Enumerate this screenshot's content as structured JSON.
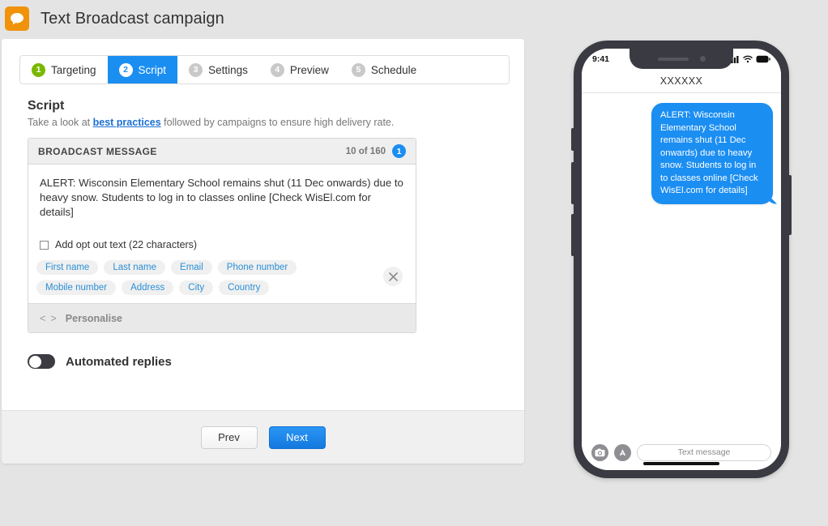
{
  "header": {
    "title": "Text Broadcast campaign",
    "app_icon": "speech-bubble-icon"
  },
  "steps": [
    {
      "num": "1",
      "label": "Targeting",
      "state": "done"
    },
    {
      "num": "2",
      "label": "Script",
      "state": "active"
    },
    {
      "num": "3",
      "label": "Settings",
      "state": "todo"
    },
    {
      "num": "4",
      "label": "Preview",
      "state": "todo"
    },
    {
      "num": "5",
      "label": "Schedule",
      "state": "todo"
    }
  ],
  "script": {
    "heading": "Script",
    "sub_prefix": "Take a look at ",
    "sub_link": "best practices",
    "sub_suffix": " followed by campaigns to ensure high delivery rate."
  },
  "composer": {
    "head_label": "BROADCAST MESSAGE",
    "char_count": "10 of 160",
    "segment_badge": "1",
    "message": "ALERT: Wisconsin Elementary School remains shut (11 Dec onwards) due to heavy snow. Students to log in to classes online [Check WisEl.com for details]",
    "optout_label": "Add opt out text (22 characters)",
    "close_icon": "close-icon",
    "chips": [
      "First name",
      "Last name",
      "Email",
      "Phone number",
      "Mobile number",
      "Address",
      "City",
      "Country"
    ],
    "footer_icon": "< >",
    "footer_label": "Personalise"
  },
  "automated": {
    "label": "Automated replies",
    "enabled": false
  },
  "footer": {
    "prev_label": "Prev",
    "next_label": "Next"
  },
  "phone": {
    "time": "9:41",
    "contact": "XXXXXX",
    "bubble_text": "ALERT: Wisconsin Elementary School remains shut (11 Dec onwards) due to heavy snow. Students to log in to classes online [Check WisEl.com for details]",
    "input_placeholder": "Text message",
    "camera_icon": "camera-icon",
    "appstore_icon": "appstore-icon"
  },
  "colors": {
    "accent_blue": "#1b8ef2",
    "brand_orange": "#f0920a",
    "step_done_green": "#7ab800",
    "page_bg": "#e4e4e4"
  }
}
